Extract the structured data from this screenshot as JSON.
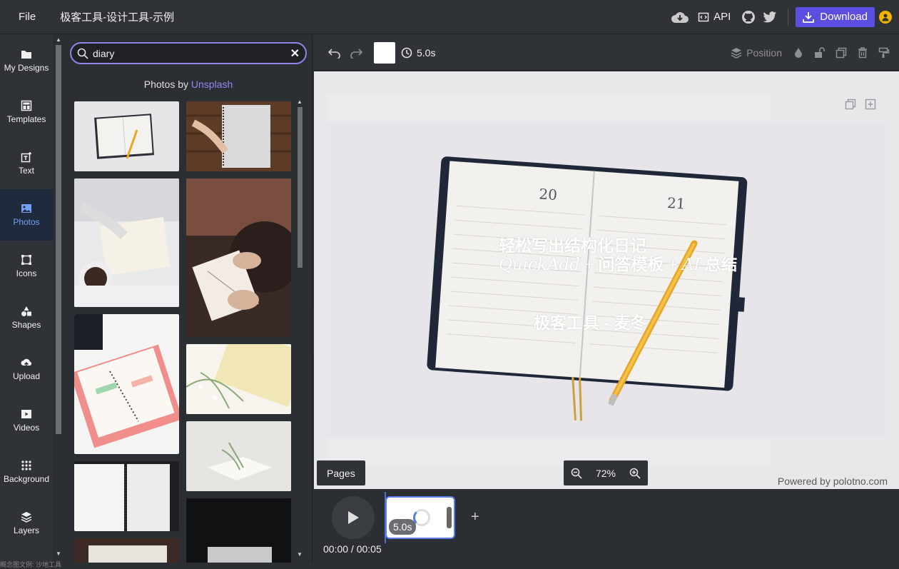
{
  "topbar": {
    "file_label": "File",
    "doc_title": "极客工具-设计工具-示例",
    "api_label": "API",
    "download_label": "Download"
  },
  "sidebar": {
    "items": [
      {
        "label": "My Designs",
        "icon": "folder-icon"
      },
      {
        "label": "Templates",
        "icon": "templates-icon"
      },
      {
        "label": "Text",
        "icon": "text-icon"
      },
      {
        "label": "Photos",
        "icon": "photos-icon",
        "active": true
      },
      {
        "label": "Icons",
        "icon": "icons-icon"
      },
      {
        "label": "Shapes",
        "icon": "shapes-icon"
      },
      {
        "label": "Upload",
        "icon": "upload-icon"
      },
      {
        "label": "Videos",
        "icon": "videos-icon"
      },
      {
        "label": "Background",
        "icon": "background-icon"
      },
      {
        "label": "Layers",
        "icon": "layers-icon"
      }
    ]
  },
  "panel": {
    "search_value": "diary",
    "photos_by_prefix": "Photos by",
    "photos_by_link": "Unsplash"
  },
  "toolbar": {
    "duration": "5.0s",
    "position_label": "Position",
    "swatch_color": "#ffffff"
  },
  "canvas": {
    "line1": "轻松写出结构化日记",
    "line2_quickadd": "QuickAdd",
    "line2_plus1": "+",
    "line2_mid": "问答模板",
    "line2_plus2": "+",
    "line2_ai": "AI",
    "line2_end": "总结",
    "line3": "极客工具 - 麦冬"
  },
  "bottom": {
    "pages_label": "Pages",
    "zoom_value": "72%",
    "powered_by": "Powered by polotno.com"
  },
  "timeline": {
    "clip_duration": "5.0s",
    "time_display": "00:00 / 00:05",
    "add_label": "+"
  },
  "status_strip": "概念图文例: 沙地工具",
  "colors": {
    "accent": "#5c4ee0",
    "active_sidebar": "#72a0f4",
    "link": "#8e8af0"
  }
}
